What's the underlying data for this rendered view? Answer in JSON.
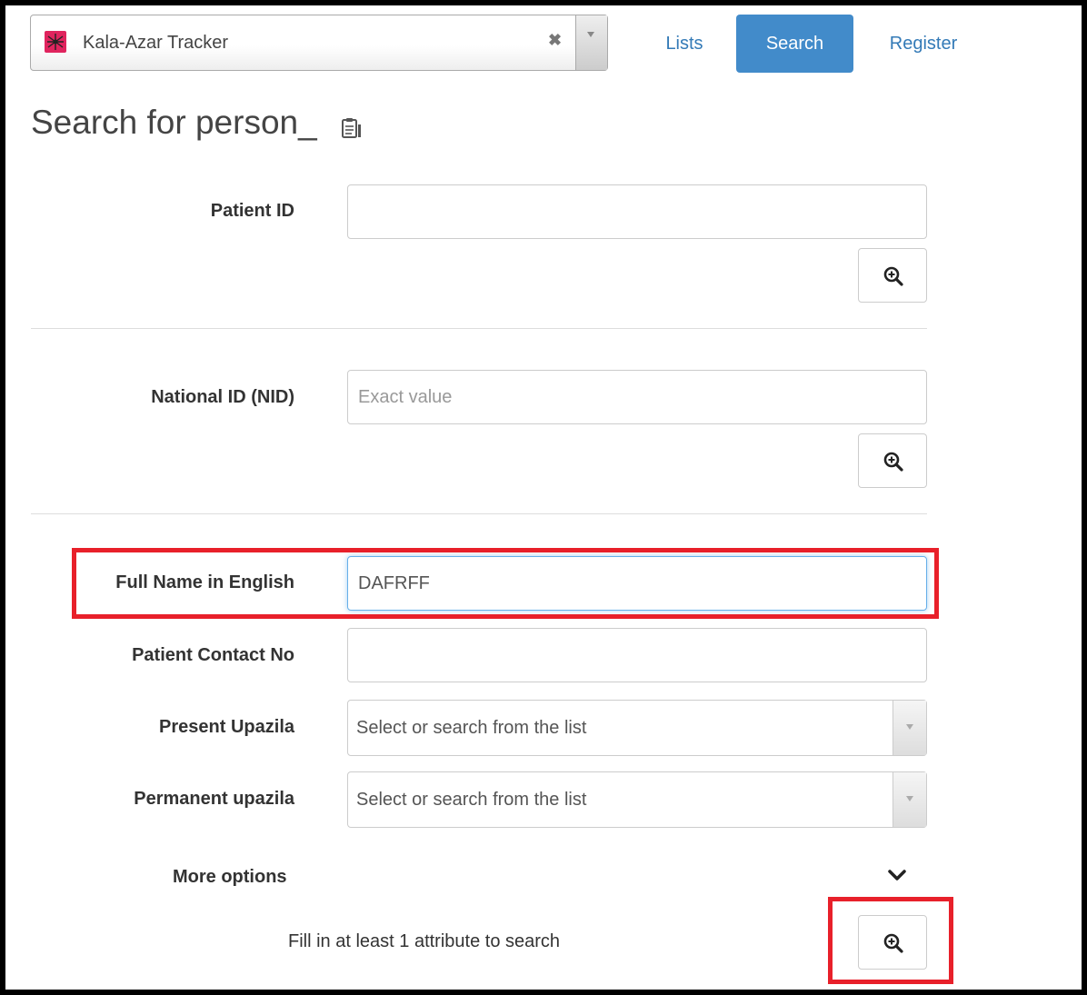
{
  "program": {
    "name": "Kala-Azar Tracker",
    "clear_symbol": "✖",
    "logo_icon": "mosquito-icon",
    "logo_color": "#e0245e"
  },
  "nav": {
    "lists": "Lists",
    "search": "Search",
    "register": "Register",
    "active_color": "#428bca"
  },
  "title": "Search for person_",
  "fields": {
    "patient_id": {
      "label": "Patient ID",
      "value": "",
      "placeholder": ""
    },
    "nid": {
      "label": "National ID (NID)",
      "value": "",
      "placeholder": "Exact value"
    },
    "full_name": {
      "label": "Full Name in English",
      "value": "DAFRFF",
      "placeholder": ""
    },
    "contact": {
      "label": "Patient Contact No",
      "value": "",
      "placeholder": ""
    },
    "present_upazila": {
      "label": "Present Upazila",
      "value": "Select or search from the list"
    },
    "permanent_upazila": {
      "label": "Permanent upazila",
      "value": "Select or search from the list"
    }
  },
  "more_options": "More options",
  "hint": "Fill in at least 1 attribute to search",
  "highlight_color": "#e8202a"
}
